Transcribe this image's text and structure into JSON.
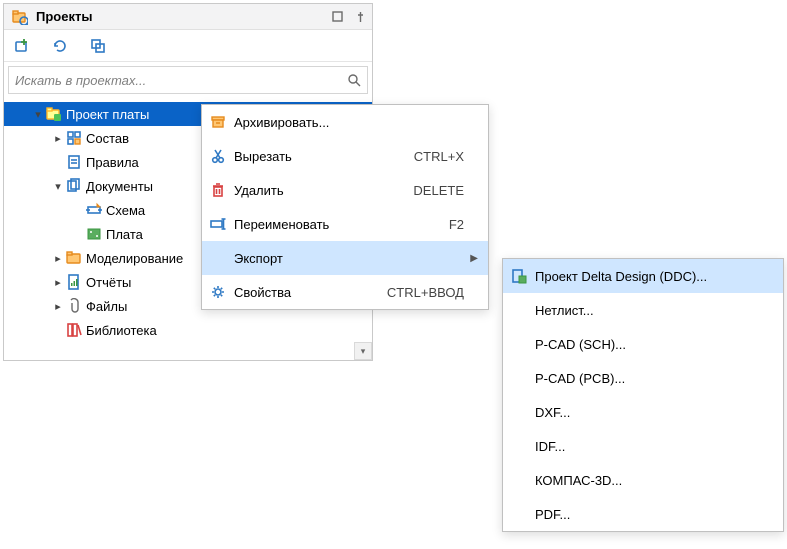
{
  "panel": {
    "title": "Проекты",
    "search_placeholder": "Искать в проектах..."
  },
  "tree": [
    {
      "depth": 0,
      "chev": "open",
      "icon": "folder-board",
      "label": "Проект платы",
      "selected": true
    },
    {
      "depth": 1,
      "chev": "closed",
      "icon": "components",
      "label": "Состав"
    },
    {
      "depth": 1,
      "chev": "none",
      "icon": "rules",
      "label": "Правила"
    },
    {
      "depth": 1,
      "chev": "open",
      "icon": "docs",
      "label": "Документы"
    },
    {
      "depth": 2,
      "chev": "none",
      "icon": "schematic",
      "label": "Схема"
    },
    {
      "depth": 2,
      "chev": "none",
      "icon": "board",
      "label": "Плата"
    },
    {
      "depth": 1,
      "chev": "closed",
      "icon": "folder",
      "label": "Моделирование"
    },
    {
      "depth": 1,
      "chev": "closed",
      "icon": "reports",
      "label": "Отчёты"
    },
    {
      "depth": 1,
      "chev": "closed",
      "icon": "files",
      "label": "Файлы"
    },
    {
      "depth": 1,
      "chev": "none",
      "icon": "library",
      "label": "Библиотека"
    }
  ],
  "menu1": [
    {
      "icon": "archive",
      "label": "Архивировать...",
      "shortcut": ""
    },
    {
      "icon": "cut",
      "label": "Вырезать",
      "shortcut": "CTRL+X"
    },
    {
      "icon": "delete",
      "label": "Удалить",
      "shortcut": "DELETE"
    },
    {
      "icon": "rename",
      "label": "Переименовать",
      "shortcut": "F2"
    },
    {
      "icon": "",
      "label": "Экспорт",
      "shortcut": "",
      "submenu": true,
      "hover": true
    },
    {
      "icon": "props",
      "label": "Свойства",
      "shortcut": "CTRL+ВВОД"
    }
  ],
  "menu2": [
    {
      "icon": "export-ddc",
      "label": "Проект Delta Design (DDC)...",
      "hover": true
    },
    {
      "icon": "",
      "label": "Нетлист..."
    },
    {
      "icon": "",
      "label": "P-CAD (SCH)..."
    },
    {
      "icon": "",
      "label": "P-CAD (PCB)..."
    },
    {
      "icon": "",
      "label": "DXF..."
    },
    {
      "icon": "",
      "label": "IDF..."
    },
    {
      "icon": "",
      "label": "КОМПАС-3D..."
    },
    {
      "icon": "",
      "label": "PDF..."
    }
  ]
}
